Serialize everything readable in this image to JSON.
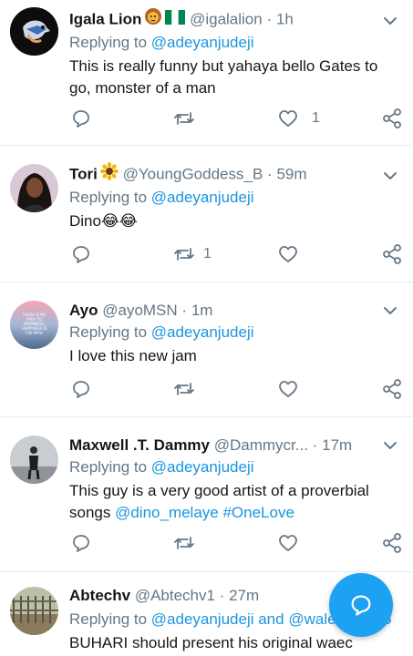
{
  "tweets": [
    {
      "name": "Igala Lion",
      "handle": "@igalalion",
      "dot": "·",
      "time": "1h",
      "reply_prefix": "Replying to ",
      "reply_to": "@adeyanjudeji",
      "text": "This is really funny but yahaya bello Gates to go, monster of a man",
      "retweets": "",
      "likes": "1"
    },
    {
      "name": "Tori",
      "handle": "@YoungGoddess_B",
      "dot": "·",
      "time": "59m",
      "reply_prefix": "Replying to ",
      "reply_to": "@adeyanjudeji",
      "text": "Dino😂😂",
      "retweets": "1",
      "likes": ""
    },
    {
      "name": "Ayo",
      "handle": "@ayoMSN",
      "dot": "·",
      "time": "1m",
      "reply_prefix": "Replying to ",
      "reply_to": "@adeyanjudeji",
      "text": "I love this new jam",
      "retweets": "",
      "likes": "",
      "avatar_text": "THERE IS NO PATH TO HAPPINESS, HAPPINESS IS THE PATH."
    },
    {
      "name": "Maxwell .T. Dammy",
      "handle": "@Dammycr...",
      "dot": "·",
      "time": "17m",
      "reply_prefix": "Replying to ",
      "reply_to": "@adeyanjudeji",
      "text_plain": "This guy is a very good artist of a proverbial songs ",
      "text_mention": "@dino_melaye #OneLove",
      "retweets": "",
      "likes": ""
    },
    {
      "name": "Abtechv",
      "handle": "@Abtechv1",
      "dot": "·",
      "time": "27m",
      "reply_prefix": "Replying to ",
      "reply_to": "@adeyanjudeji and @wale",
      "reply_suffix": "5",
      "text": "BUHARI should present his original waec"
    }
  ],
  "colors": {
    "accent": "#1da1f2",
    "mention": "#1b95e0",
    "muted": "#657786",
    "icon": "#657786"
  },
  "icons": [
    "reply-icon",
    "retweet-icon",
    "like-icon",
    "share-icon",
    "caret-down-icon",
    "compose-icon"
  ]
}
